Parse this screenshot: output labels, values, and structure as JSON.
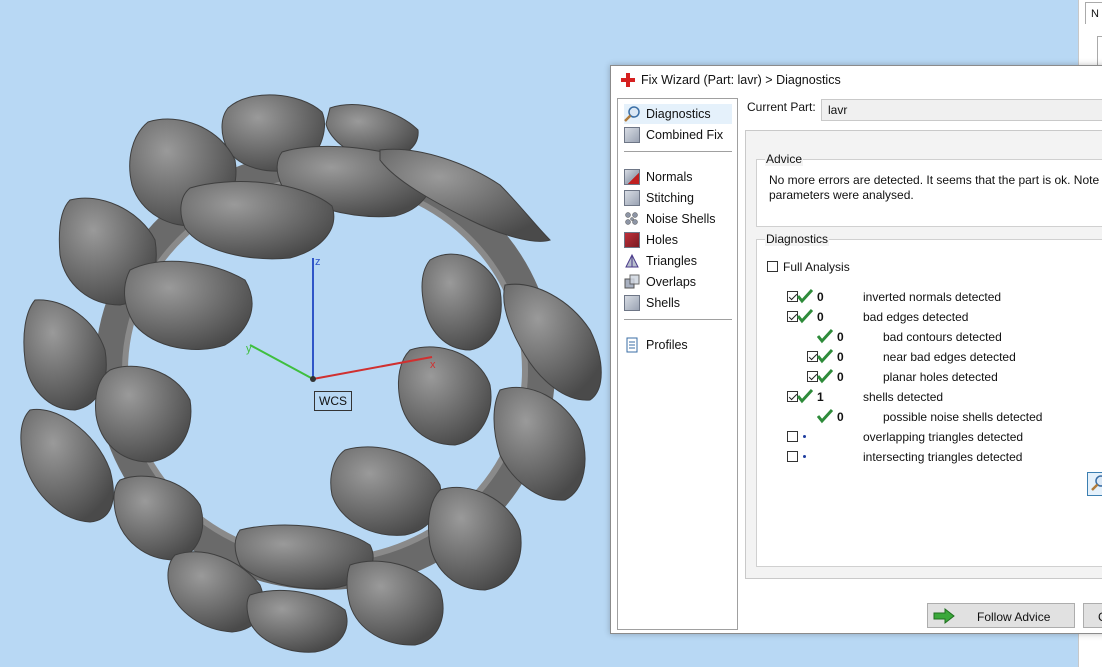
{
  "viewport": {
    "axis_z": "z",
    "axis_y": "y",
    "axis_x": "x",
    "wcs_label": "WCS",
    "background": "#b8d8f4"
  },
  "right_strip": {
    "tab_label": "N"
  },
  "dialog": {
    "title": "Fix Wizard (Part: lavr) > Diagnostics",
    "nav": {
      "top": [
        {
          "label": "Diagnostics",
          "icon": "magnifier-icon",
          "selected": true
        },
        {
          "label": "Combined Fix",
          "icon": "cube-icon"
        }
      ],
      "middle": [
        {
          "label": "Normals",
          "icon": "normals-icon"
        },
        {
          "label": "Stitching",
          "icon": "stitching-icon"
        },
        {
          "label": "Noise Shells",
          "icon": "noise-shells-icon"
        },
        {
          "label": "Holes",
          "icon": "holes-icon"
        },
        {
          "label": "Triangles",
          "icon": "triangles-icon"
        },
        {
          "label": "Overlaps",
          "icon": "overlaps-icon"
        },
        {
          "label": "Shells",
          "icon": "shells-icon"
        }
      ],
      "bottom": [
        {
          "label": "Profiles",
          "icon": "document-icon"
        }
      ]
    },
    "current_part_label": "Current Part:",
    "current_part_value": "lavr",
    "advice": {
      "title": "Advice",
      "line1": "No more errors are detected. It seems that the part is ok. Note tha",
      "line2": "parameters were analysed."
    },
    "diagnostics": {
      "title": "Diagnostics",
      "full_analysis_label": "Full Analysis",
      "full_analysis_checked": false,
      "rows": [
        {
          "checked": true,
          "status": "ok",
          "count": "0",
          "label": "inverted normals detected",
          "indent": 0,
          "has_checkbox": true
        },
        {
          "checked": true,
          "status": "ok",
          "count": "0",
          "label": "bad edges detected",
          "indent": 0,
          "has_checkbox": true
        },
        {
          "checked": false,
          "status": "ok",
          "count": "0",
          "label": "bad contours detected",
          "indent": 1,
          "has_checkbox": false
        },
        {
          "checked": true,
          "status": "ok",
          "count": "0",
          "label": "near bad edges detected",
          "indent": 1,
          "has_checkbox": true
        },
        {
          "checked": true,
          "status": "ok",
          "count": "0",
          "label": "planar holes detected",
          "indent": 1,
          "has_checkbox": true
        },
        {
          "checked": true,
          "status": "ok",
          "count": "1",
          "label": "shells detected",
          "indent": 0,
          "has_checkbox": true
        },
        {
          "checked": false,
          "status": "ok",
          "count": "0",
          "label": "possible noise shells detected",
          "indent": 1,
          "has_checkbox": false
        },
        {
          "checked": false,
          "status": "none",
          "count": "",
          "label": "overlapping triangles detected",
          "indent": 0,
          "has_checkbox": true
        },
        {
          "checked": false,
          "status": "none",
          "count": "",
          "label": "intersecting triangles detected",
          "indent": 0,
          "has_checkbox": true
        }
      ]
    },
    "follow_advice_label": "Follow Advice",
    "other_button_label": "C",
    "colors": {
      "check_green": "#2e8b3a",
      "dot_blue": "#1f3ea0",
      "arrow_green": "#3aa83a"
    }
  }
}
